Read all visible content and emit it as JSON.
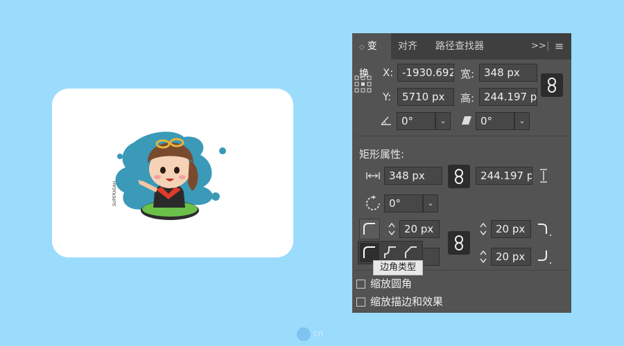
{
  "tabs": [
    {
      "label": "变换",
      "active": true
    },
    {
      "label": "对齐",
      "active": false
    },
    {
      "label": "路径查找器",
      "active": false
    }
  ],
  "panel_controls": {
    "expand": ">>",
    "menu": "≡"
  },
  "transform": {
    "x_label": "X:",
    "x_value": "-1930.692",
    "y_label": "Y:",
    "y_value": "5710 px",
    "w_label": "宽:",
    "w_value": "348 px",
    "h_label": "高:",
    "h_value": "244.197 p",
    "rotate_value": "0°",
    "shear_value": "0°"
  },
  "rect_props": {
    "title": "矩形属性:",
    "width_value": "348 px",
    "height_value": "244.197 p",
    "rotation_value": "0°",
    "corner_tl": "20 px",
    "corner_tr": "20 px",
    "corner_bl": "px",
    "corner_br": "20 px"
  },
  "tooltip": "边角类型",
  "checkboxes": {
    "scale_corners": "缩放圆角",
    "scale_strokes": "缩放描边和效果"
  },
  "watermark": "cn",
  "artwork_credit": "SUPERXEAH",
  "colors": {
    "background": "#9bdcfd",
    "panel": "#535353",
    "tabbar": "#3f3f3f"
  }
}
